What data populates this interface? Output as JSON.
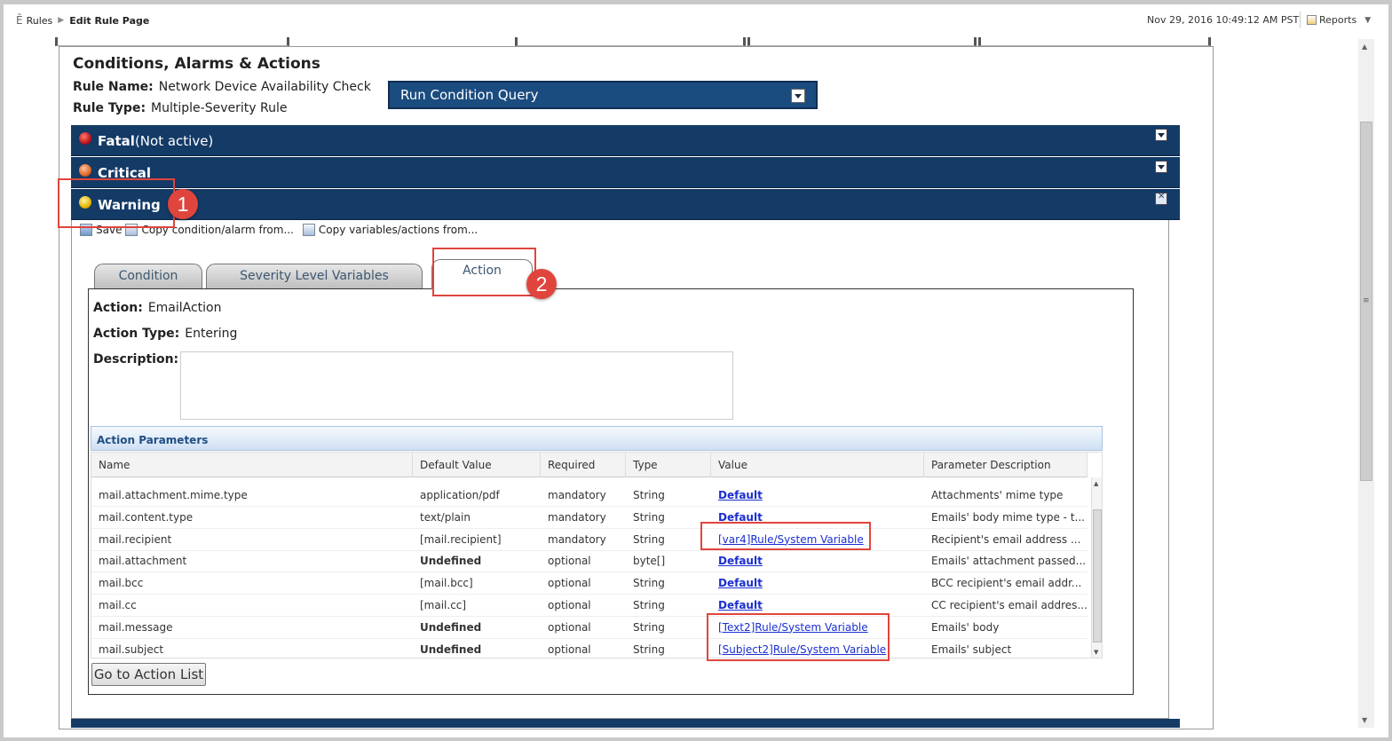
{
  "breadcrumb": {
    "root": "Rules",
    "current": "Edit Rule Page"
  },
  "timestamp": "Nov 29, 2016 10:49:12 AM PST",
  "reports_label": "Reports",
  "page": {
    "title": "Conditions, Alarms & Actions",
    "rule_name_label": "Rule Name:",
    "rule_name": "Network Device Availability Check",
    "rule_type_label": "Rule Type:",
    "rule_type": "Multiple-Severity Rule",
    "query_button": "Run Condition Query"
  },
  "severities": [
    {
      "name": "Fatal",
      "suffix": "(Not active)",
      "color": "#c0141c"
    },
    {
      "name": "Critical",
      "suffix": "",
      "color": "#e0662a"
    },
    {
      "name": "Warning",
      "suffix": "",
      "color": "#e6b800"
    }
  ],
  "toolbar": {
    "save": "Save",
    "copy_condition": "Copy condition/alarm from...",
    "copy_variables": "Copy variables/actions from..."
  },
  "tabs": [
    "Condition",
    "Severity Level Variables",
    "Action"
  ],
  "action": {
    "action_label": "Action:",
    "action_value": "EmailAction",
    "type_label": "Action Type:",
    "type_value": "Entering",
    "description_label": "Description:"
  },
  "params": {
    "title": "Action Parameters",
    "headers": [
      "Name",
      "Default Value",
      "Required",
      "Type",
      "Value",
      "Parameter Description"
    ],
    "rows": [
      [
        "mail.attachment.mime.type",
        "application/pdf",
        "mandatory",
        "String",
        "Default",
        "Attachments' mime type"
      ],
      [
        "mail.content.type",
        "text/plain",
        "mandatory",
        "String",
        "Default",
        "Emails' body mime type - t..."
      ],
      [
        "mail.recipient",
        "[mail.recipient]",
        "mandatory",
        "String",
        "[var4]Rule/System Variable",
        "Recipient's email address ..."
      ],
      [
        "mail.attachment",
        "Undefined",
        "optional",
        "byte[]",
        "Default",
        "Emails' attachment passed..."
      ],
      [
        "mail.bcc",
        "[mail.bcc]",
        "optional",
        "String",
        "Default",
        "BCC recipient's email addr..."
      ],
      [
        "mail.cc",
        "[mail.cc]",
        "optional",
        "String",
        "Default",
        "CC recipient's email addres..."
      ],
      [
        "mail.message",
        "Undefined",
        "optional",
        "String",
        "[Text2]Rule/System Variable",
        "Emails' body"
      ],
      [
        "mail.subject",
        "Undefined",
        "optional",
        "String",
        "[Subject2]Rule/System Variable",
        "Emails' subject"
      ]
    ]
  },
  "go_button": "Go to Action List",
  "annotations": [
    "1",
    "2"
  ],
  "colors": {
    "header_blue": "#143a66",
    "annotation_red": "#e0453d",
    "link_blue": "#1a2fd0"
  }
}
